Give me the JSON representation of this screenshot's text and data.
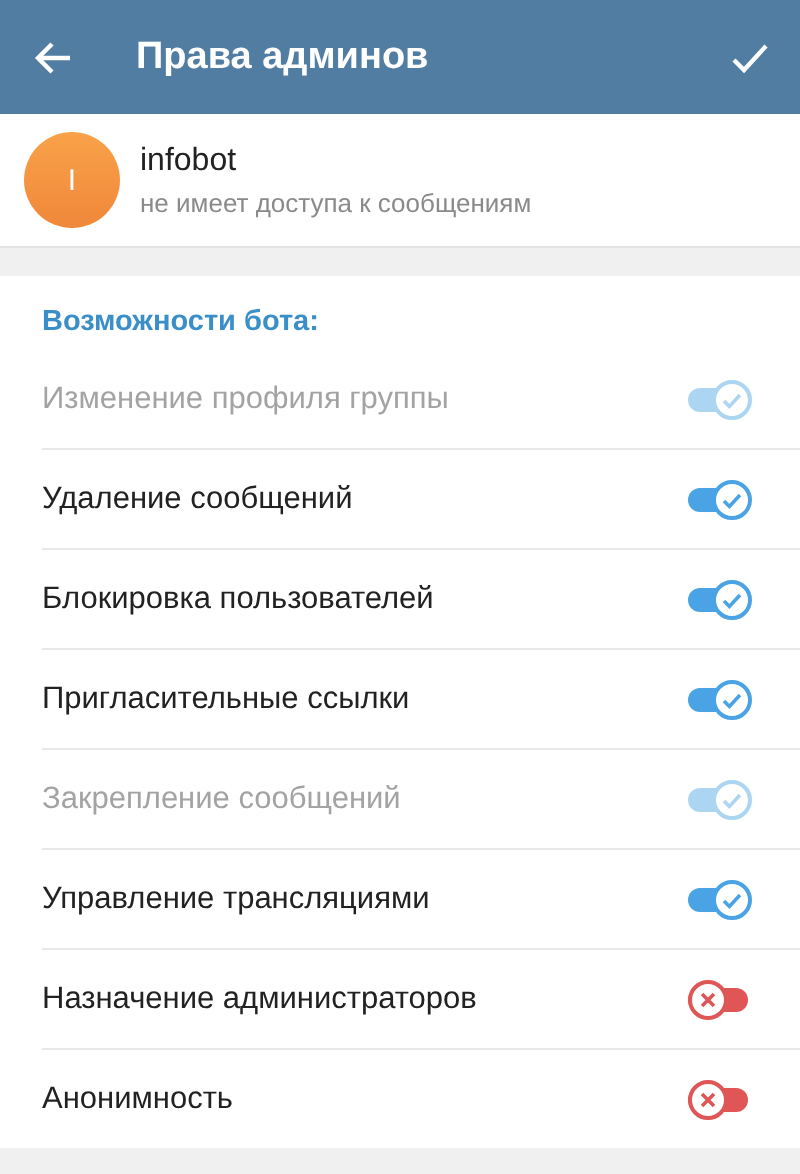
{
  "header": {
    "title": "Права админов"
  },
  "bot": {
    "avatar_letter": "I",
    "name": "infobot",
    "status": "не имеет доступа к сообщениям"
  },
  "section_title": "Возможности бота:",
  "permissions": [
    {
      "label": "Изменение профиля группы",
      "on": true,
      "disabled": true
    },
    {
      "label": "Удаление сообщений",
      "on": true,
      "disabled": false
    },
    {
      "label": "Блокировка пользователей",
      "on": true,
      "disabled": false
    },
    {
      "label": "Пригласительные ссылки",
      "on": true,
      "disabled": false
    },
    {
      "label": "Закрепление сообщений",
      "on": true,
      "disabled": true
    },
    {
      "label": "Управление трансляциями",
      "on": true,
      "disabled": false
    },
    {
      "label": "Назначение администраторов",
      "on": false,
      "disabled": false
    },
    {
      "label": "Анонимность",
      "on": false,
      "disabled": false
    }
  ]
}
